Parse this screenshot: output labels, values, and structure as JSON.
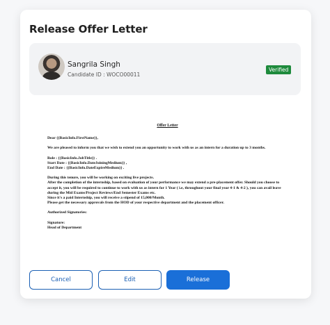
{
  "modal": {
    "title": "Release Offer Letter"
  },
  "candidate": {
    "name": "Sangrila Singh",
    "id": "Candidate ID : WOCO00011",
    "status": "Verified",
    "status_color": "#1e8a3c"
  },
  "letter": {
    "title": "Offer Letter",
    "salutation": "Dear  {{BasicInfo.FirstName}},",
    "intro": "We are pleased to inform you that we wish to extend you an opportunity to work with us as an intern for a duration up to 3 months.",
    "role": "Role :  {{BasicInfo.JobTitle}}  .",
    "start_date": "Start Date :  {{BasicInfo.DateJoiningMedium}}  ,",
    "end_date": "End Date :  {{BasicInfo.DateExpireMedium}}  .",
    "para1": "During this tenure, you will be working on exciting live projects.",
    "para2": "After the completion of the internship, based on evaluation of your performance we may extend a pre-placement offer. Should you choose to accept it, you will be required to continue to work with us as intern for 1 Year ( i.e, throughout your final year 4-1 & 4-2 ), you can avail leave during the Mid Exams/Project Reviews/End Semester Exams etc.",
    "para3": "Since it's a paid Internship, you will receive a stipend of 15,000/Month.",
    "para4": "Please get the necessary approvals from the HOD of your respective department and the placement officer.",
    "signatories": "Authorized Signatories:",
    "signature": "Signature:",
    "head": "Head of Department"
  },
  "actions": {
    "cancel_label": "Cancel",
    "edit_label": "Edit",
    "release_label": "Release"
  },
  "colors": {
    "primary": "#1a6fd8",
    "outline": "#1a5fb4"
  }
}
